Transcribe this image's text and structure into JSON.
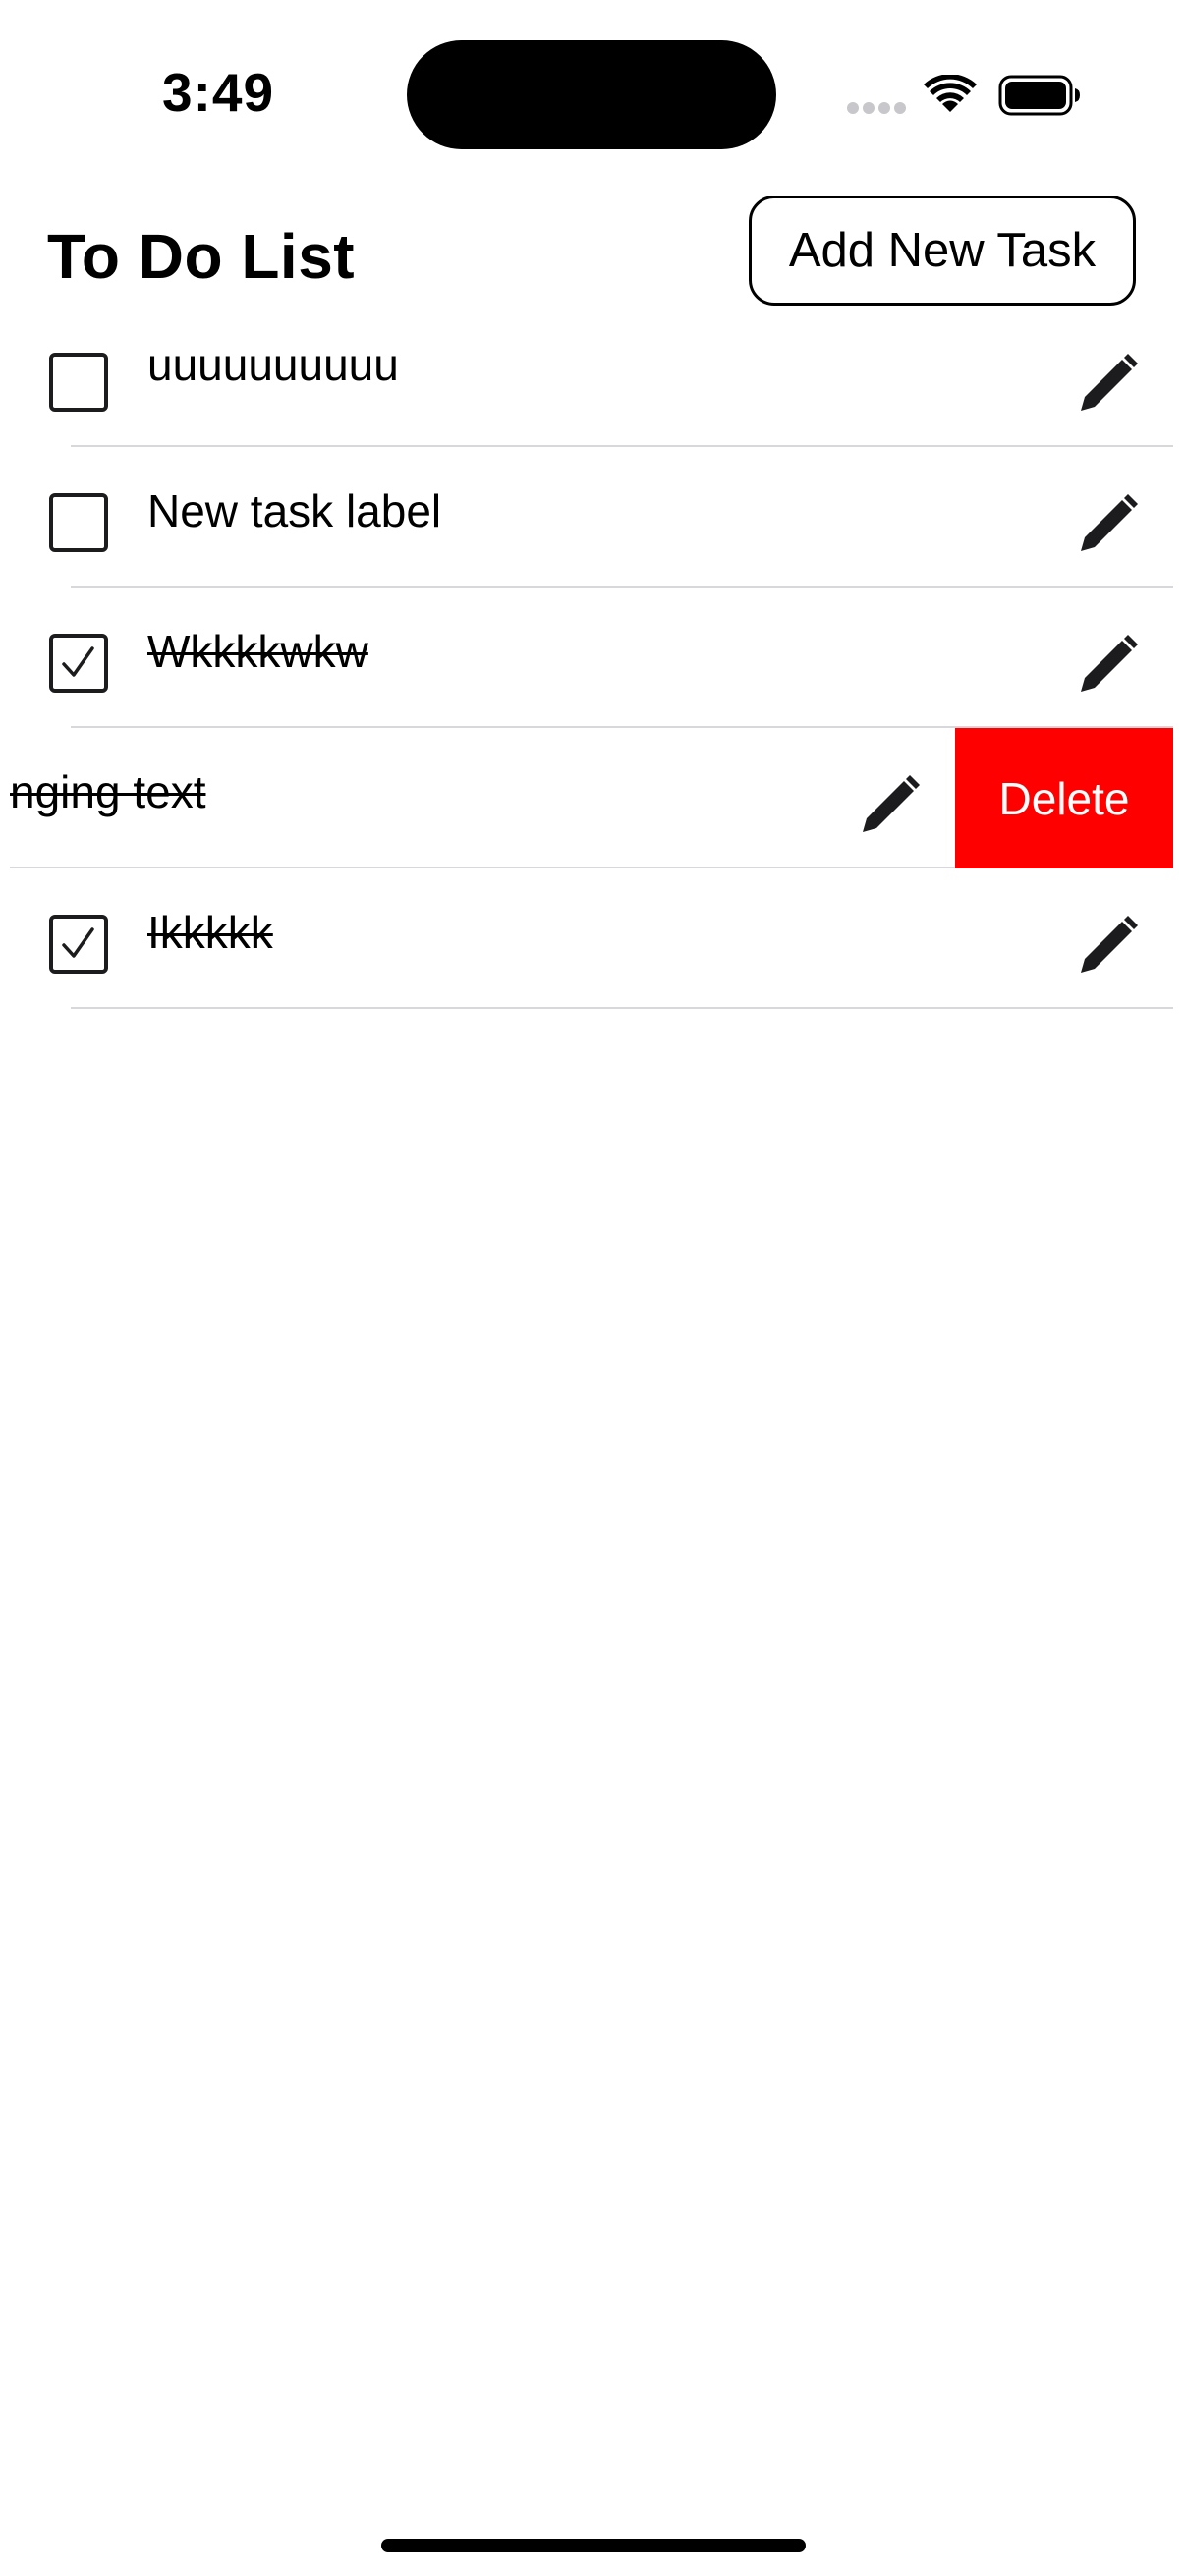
{
  "status_bar": {
    "time": "3:49"
  },
  "header": {
    "title": "To Do List",
    "add_button_label": "Add New Task"
  },
  "tasks": [
    {
      "label": "uuuuuuuuuu",
      "completed": false
    },
    {
      "label": "New task label",
      "completed": false
    },
    {
      "label": "Wkkkkwkw",
      "completed": true
    },
    {
      "label": "nging text",
      "completed": true,
      "swiped": true
    },
    {
      "label": "Ikkkkk",
      "completed": true
    }
  ],
  "swipe_action": {
    "delete_label": "Delete",
    "color": "#fe0000"
  },
  "icons": {
    "edit": "pencil-icon",
    "checked": "checkmark-icon"
  }
}
